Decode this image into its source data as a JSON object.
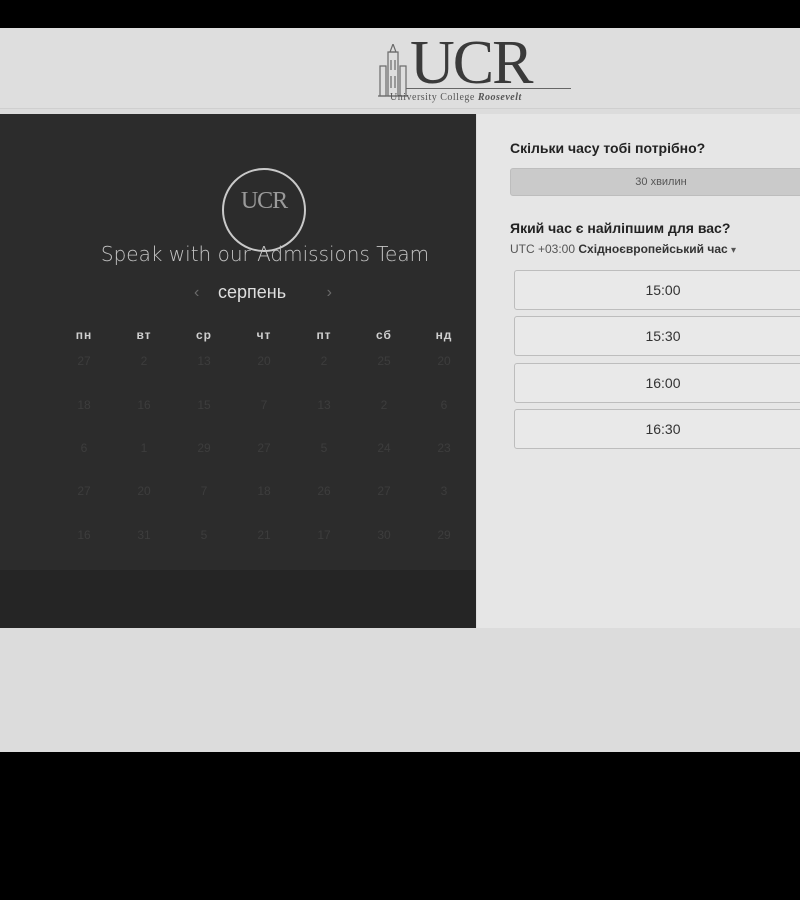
{
  "header": {
    "logo": {
      "text": "UCR",
      "subtitle": "University College",
      "subtitle_bold": "Roosevelt"
    }
  },
  "left": {
    "logo_small": "UCR",
    "title": "Speak with our Admissions Team",
    "month": "серпень",
    "prev_icon": "chevron-left-icon",
    "next_icon": "chevron-right-icon",
    "weekdays": [
      "пн",
      "вт",
      "ср",
      "чт",
      "пт",
      "сб",
      "нд"
    ],
    "weeks": [
      [
        "27",
        "2",
        "13",
        "20",
        "2",
        "25",
        "20"
      ],
      [
        "18",
        "16",
        "15",
        "7",
        "13",
        "2",
        "6"
      ],
      [
        "6",
        "1",
        "29",
        "27",
        "5",
        "24",
        "23"
      ],
      [
        "27",
        "20",
        "7",
        "18",
        "26",
        "27",
        "3"
      ],
      [
        "16",
        "31",
        "5",
        "21",
        "17",
        "30",
        "29"
      ]
    ]
  },
  "right": {
    "duration_question": "Скільки часу тобі потрібно?",
    "duration_value": "30 хвилин",
    "time_question": "Який час є найліпшим для вас?",
    "timezone_offset": "UTC +03:00",
    "timezone_name": "Східноєвропейський час",
    "timezone_icon": "caret-down-icon",
    "slots": [
      "15:00",
      "15:30",
      "16:00",
      "16:30"
    ]
  }
}
